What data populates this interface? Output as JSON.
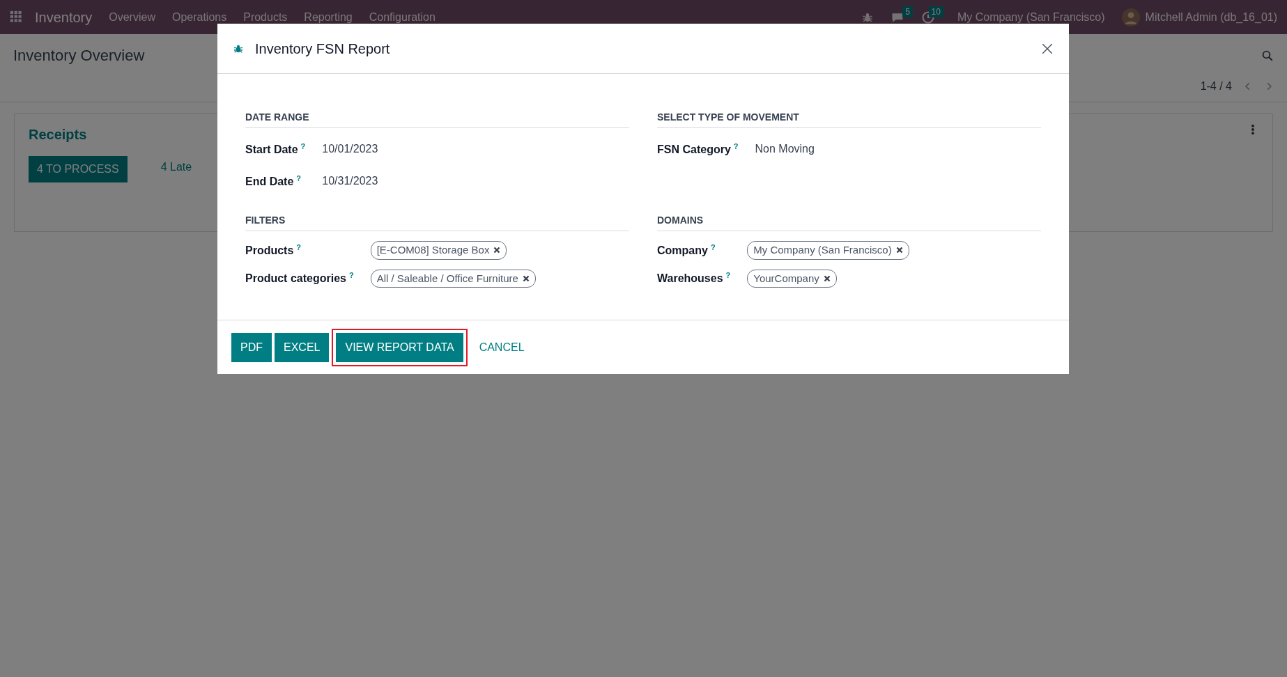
{
  "navbar": {
    "app_name": "Inventory",
    "menu": [
      "Overview",
      "Operations",
      "Products",
      "Reporting",
      "Configuration"
    ],
    "chat_count": "5",
    "activity_count": "10",
    "company": "My Company (San Francisco)",
    "user": "Mitchell Admin (db_16_01)"
  },
  "page": {
    "breadcrumb": "Inventory Overview",
    "pager": "1-4 / 4",
    "card": {
      "title": "Receipts",
      "action": "4 TO PROCESS",
      "late": "4 Late"
    }
  },
  "dialog": {
    "title": "Inventory FSN Report",
    "sections": [
      {
        "title": "DATE RANGE",
        "fields": [
          {
            "label": "Start Date",
            "help": "?",
            "kind": "text",
            "value": "10/01/2023"
          },
          {
            "label": "End Date",
            "help": "?",
            "kind": "text",
            "value": "10/31/2023"
          }
        ]
      },
      {
        "title": "SELECT TYPE OF MOVEMENT",
        "fields": [
          {
            "label": "FSN Category",
            "help": "?",
            "kind": "text",
            "value": "Non Moving"
          }
        ]
      },
      {
        "title": "FILTERS",
        "fields": [
          {
            "label": "Products",
            "help": "?",
            "kind": "tags",
            "tags": [
              "[E-COM08] Storage Box"
            ]
          },
          {
            "label": "Product categories",
            "help": "?",
            "kind": "tags",
            "tags": [
              "All / Saleable / Office Furniture"
            ]
          }
        ]
      },
      {
        "title": "DOMAINS",
        "fields": [
          {
            "label": "Company",
            "help": "?",
            "kind": "tags",
            "tags": [
              "My Company (San Francisco)"
            ]
          },
          {
            "label": "Warehouses",
            "help": "?",
            "kind": "tags",
            "tags": [
              "YourCompany"
            ]
          }
        ]
      }
    ],
    "buttons": [
      {
        "label": "PDF",
        "kind": "primary",
        "highlighted": false
      },
      {
        "label": "EXCEL",
        "kind": "primary",
        "highlighted": false
      },
      {
        "label": "VIEW REPORT DATA",
        "kind": "primary",
        "highlighted": true
      },
      {
        "label": "CANCEL",
        "kind": "link",
        "highlighted": false
      }
    ]
  }
}
